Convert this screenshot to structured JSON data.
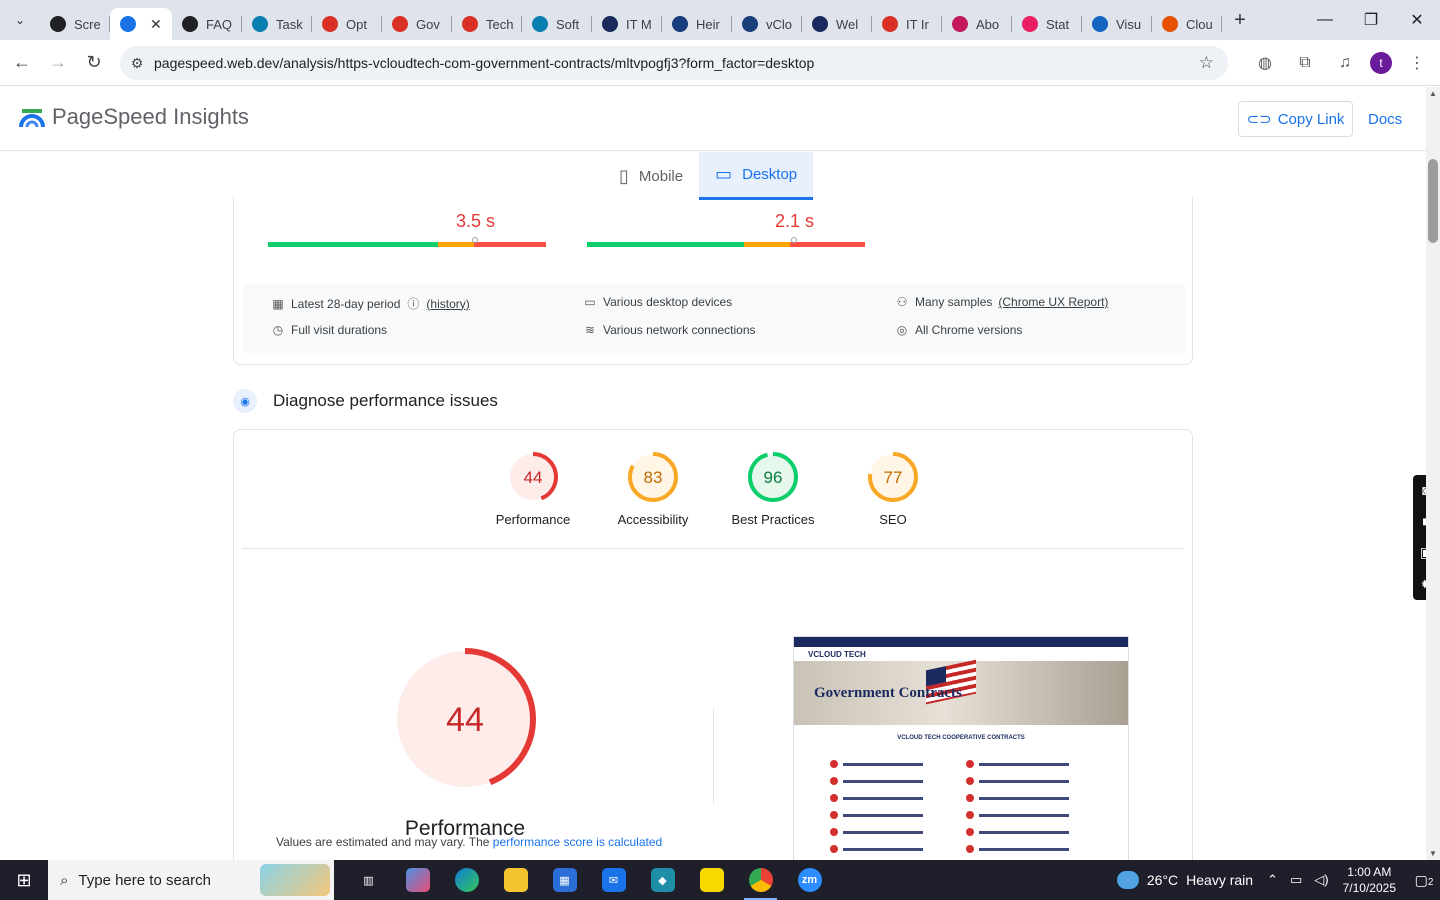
{
  "browser": {
    "tabs": [
      {
        "title": "Scre",
        "color": "#202124"
      },
      {
        "title": "",
        "color": "#1a73e8",
        "active": true
      },
      {
        "title": "FAQ",
        "color": "#202124"
      },
      {
        "title": "Task",
        "color": "#0b7fb0"
      },
      {
        "title": "Opt",
        "color": "#d93025"
      },
      {
        "title": "Gov",
        "color": "#d93025"
      },
      {
        "title": "Tech",
        "color": "#d93025"
      },
      {
        "title": "Soft",
        "color": "#0b7fb0"
      },
      {
        "title": "IT M",
        "color": "#1b2a5e"
      },
      {
        "title": "Heir",
        "color": "#1a3d7c"
      },
      {
        "title": "vClo",
        "color": "#1a3d7c"
      },
      {
        "title": "Wel",
        "color": "#1b2a5e"
      },
      {
        "title": "IT Ir",
        "color": "#d93025"
      },
      {
        "title": "Abo",
        "color": "#c2185b"
      },
      {
        "title": "Stat",
        "color": "#e91e63"
      },
      {
        "title": "Visu",
        "color": "#1565c0"
      },
      {
        "title": "Clou",
        "color": "#e65100"
      }
    ],
    "url": "pagespeed.web.dev/analysis/https-vcloudtech-com-government-contracts/mltvpogfj3?form_factor=desktop",
    "avatar_letter": "t"
  },
  "header": {
    "brand": "PageSpeed Insights",
    "copy_link": "Copy Link",
    "docs": "Docs"
  },
  "device_tabs": {
    "mobile": "Mobile",
    "desktop": "Desktop"
  },
  "field_data": {
    "metric1_value": "3.5 s",
    "metric2_value": "2.1 s",
    "meta": {
      "period": "Latest 28-day period",
      "history": "(history)",
      "devices": "Various desktop devices",
      "samples": "Many samples",
      "crux": "(Chrome UX Report)",
      "durations": "Full visit durations",
      "network": "Various network connections",
      "chrome": "All Chrome versions"
    }
  },
  "diagnose": {
    "title": "Diagnose performance issues"
  },
  "scores": [
    {
      "label": "Performance",
      "value": 44,
      "color": "#e53935",
      "bg": "#fdecea"
    },
    {
      "label": "Accessibility",
      "value": 83,
      "color": "#f9a825",
      "bg": "#fff6e5"
    },
    {
      "label": "Best Practices",
      "value": 96,
      "color": "#0cce6b",
      "bg": "#e6f7ec"
    },
    {
      "label": "SEO",
      "value": 77,
      "color": "#f9a825",
      "bg": "#fff6e5"
    }
  ],
  "performance_detail": {
    "score": 44,
    "label": "Performance",
    "note_prefix": "Values are estimated and may vary. The ",
    "note_link": "performance score is calculated"
  },
  "thumbnail": {
    "logo": "VCLOUD TECH",
    "hero_title": "Government Contracts",
    "subtitle": "VCLOUD TECH COOPERATIVE CONTRACTS"
  },
  "taskbar": {
    "search_placeholder": "Type here to search",
    "temperature": "26°C",
    "weather": "Heavy rain",
    "time": "1:00 AM",
    "date": "7/10/2025",
    "notifications": "2"
  }
}
